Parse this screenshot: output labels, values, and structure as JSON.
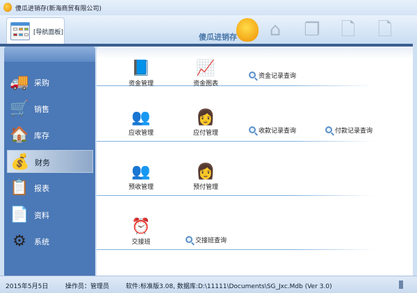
{
  "window": {
    "title": "傻瓜进销存(新海商贸有限公司)"
  },
  "toolbar": {
    "nav_tab": "[导航面板]",
    "brand": "傻瓜进销存",
    "buttons": [
      {
        "name": "home",
        "glyph": "⌂"
      },
      {
        "name": "windows",
        "glyph": "❐"
      },
      {
        "name": "add-document",
        "glyph": "🗋"
      },
      {
        "name": "remove-document",
        "glyph": "🗋"
      }
    ]
  },
  "sidebar": {
    "items": [
      {
        "label": "采购",
        "icon": "truck-icon",
        "glyph": "🚚"
      },
      {
        "label": "销售",
        "icon": "cart-icon",
        "glyph": "🛒"
      },
      {
        "label": "库存",
        "icon": "house-icon",
        "glyph": "🏠"
      },
      {
        "label": "财务",
        "icon": "money-icon",
        "glyph": "💰",
        "selected": true
      },
      {
        "label": "报表",
        "icon": "report-icon",
        "glyph": "📋"
      },
      {
        "label": "资料",
        "icon": "sheet-icon",
        "glyph": "📄"
      },
      {
        "label": "系统",
        "icon": "gear-icon",
        "glyph": "⚙"
      }
    ]
  },
  "main": {
    "modules": [
      {
        "label": "资金管理",
        "icon": "ledger-icon",
        "glyph": "📘"
      },
      {
        "label": "资金图表",
        "icon": "chart-cart-icon",
        "glyph": "📈"
      },
      {
        "label": "应收管理",
        "icon": "receivable-icon",
        "glyph": "👥"
      },
      {
        "label": "应付管理",
        "icon": "payable-icon",
        "glyph": "👩"
      },
      {
        "label": "预收管理",
        "icon": "prereceive-icon",
        "glyph": "👥"
      },
      {
        "label": "预付管理",
        "icon": "prepay-icon",
        "glyph": "👩"
      },
      {
        "label": "交接班",
        "icon": "alarm-clock-icon",
        "glyph": "⏰"
      }
    ],
    "links": [
      "资金记录查询",
      "收款记录查询",
      "付款记录查询",
      "交接班查询"
    ]
  },
  "status": {
    "date": "2015年5月5日",
    "operator": "操作员：管理员",
    "software": "软件:标准版3.08,   数据库:D:\\11111\\Documents\\SG_Jxc.Mdb (Ver 3.0)"
  },
  "colors": {
    "sidebar": "#4b78b6",
    "accent": "#3a5f90"
  }
}
